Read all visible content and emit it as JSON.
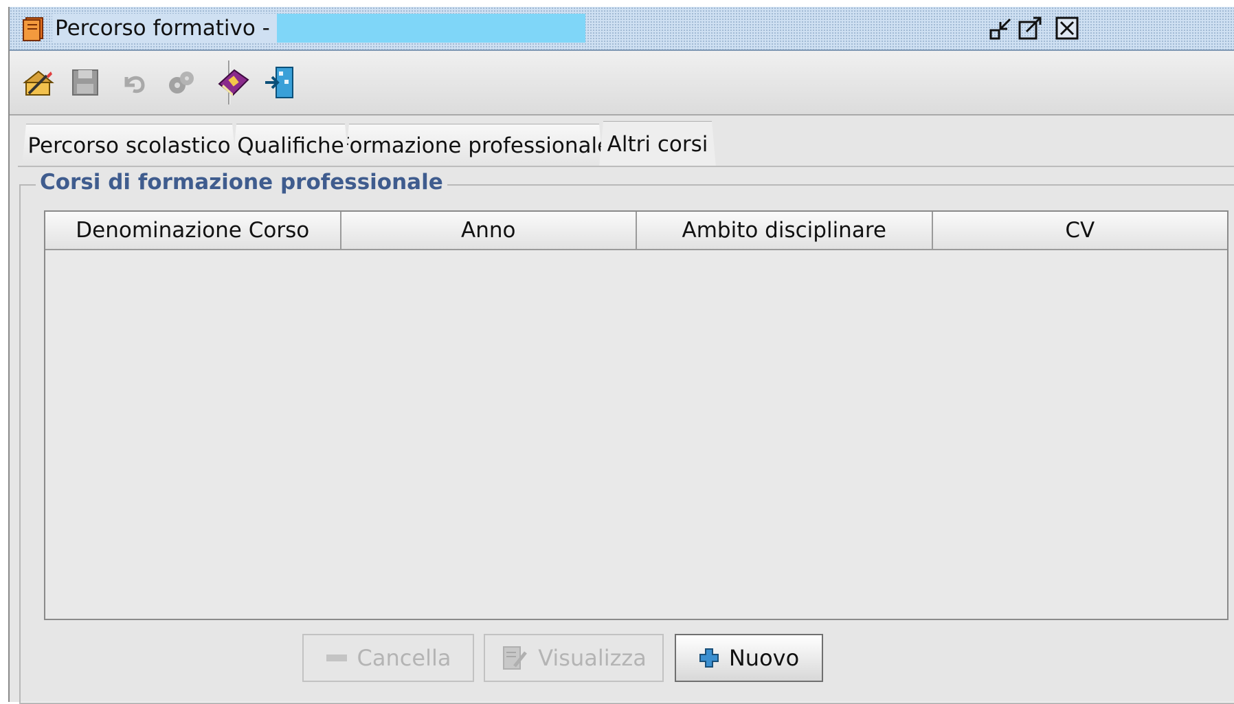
{
  "window": {
    "title": "Percorso formativo -",
    "app_icon": "book-icon",
    "controls": [
      "minimize-icon",
      "maximize-icon",
      "close-icon"
    ]
  },
  "toolbar": {
    "items": [
      {
        "icon": "edit-icon",
        "enabled": true
      },
      {
        "icon": "save-icon",
        "enabled": false
      },
      {
        "icon": "undo-icon",
        "enabled": false
      },
      {
        "icon": "gears-icon",
        "enabled": false
      },
      {
        "icon": "book-icon",
        "enabled": true
      },
      {
        "icon": "exit-icon",
        "enabled": true
      }
    ]
  },
  "tabs": [
    {
      "label": "Percorso scolastico",
      "active": false
    },
    {
      "label": "Qualifiche",
      "active": false
    },
    {
      "label": "Formazione professionale",
      "active": false
    },
    {
      "label": "Altri corsi",
      "active": true
    }
  ],
  "section": {
    "title": "Corsi di formazione professionale",
    "table": {
      "columns": [
        "Denominazione Corso",
        "Anno",
        "Ambito disciplinare",
        "CV"
      ],
      "rows": []
    }
  },
  "buttons": {
    "delete": {
      "label": "Cancella",
      "enabled": false
    },
    "view": {
      "label": "Visualizza",
      "enabled": false
    },
    "new": {
      "label": "Nuovo",
      "enabled": true
    }
  },
  "colors": {
    "accent_text": "#3f5c8e",
    "redaction": "#7fd6f8"
  }
}
